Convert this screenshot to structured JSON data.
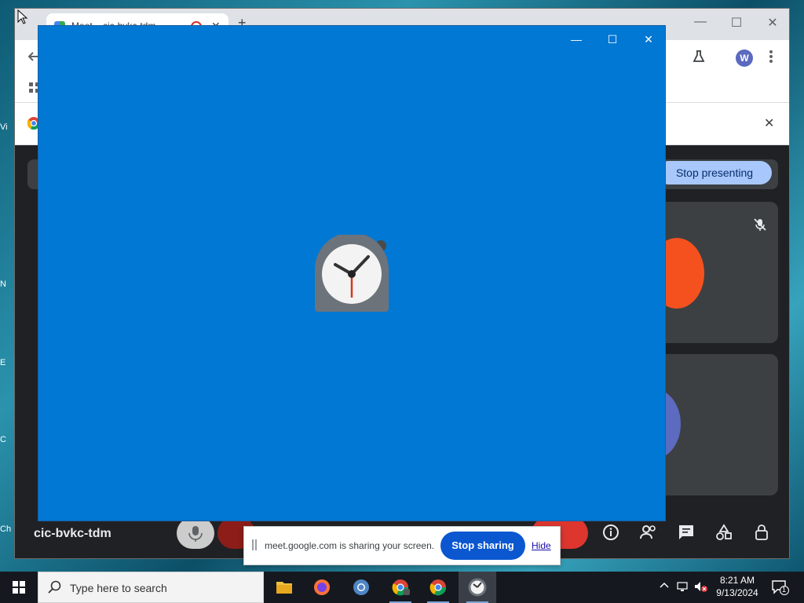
{
  "desktop": {
    "icon_letters": [
      "Vi",
      "N",
      "E",
      "C",
      "Ch"
    ]
  },
  "chrome": {
    "tab_title": "Meet – cic-bvkc-tdm",
    "tab_close_glyph": "✕",
    "new_tab_glyph": "+",
    "min_glyph": "—",
    "max_glyph": "☐",
    "close_glyph": "✕",
    "avatar_letter": "W",
    "infobar_close_glyph": "✕"
  },
  "meet": {
    "stop_presenting_label": "Stop presenting",
    "meeting_code": "cic-bvkc-tdm"
  },
  "share_bar": {
    "message": "meet.google.com is sharing your screen.",
    "stop_sharing_label": "Stop sharing",
    "hide_label": "Hide"
  },
  "clock_window": {
    "min_glyph": "—",
    "max_glyph": "☐",
    "close_glyph": "✕"
  },
  "taskbar": {
    "search_placeholder": "Type here to search",
    "time": "8:21 AM",
    "date": "9/13/2024",
    "notification_count": "1"
  },
  "colors": {
    "clock_bg": "#0078d4",
    "meet_bg": "#202124",
    "stop_sharing": "#0b57d0",
    "stop_presenting": "#a8c7fa"
  }
}
